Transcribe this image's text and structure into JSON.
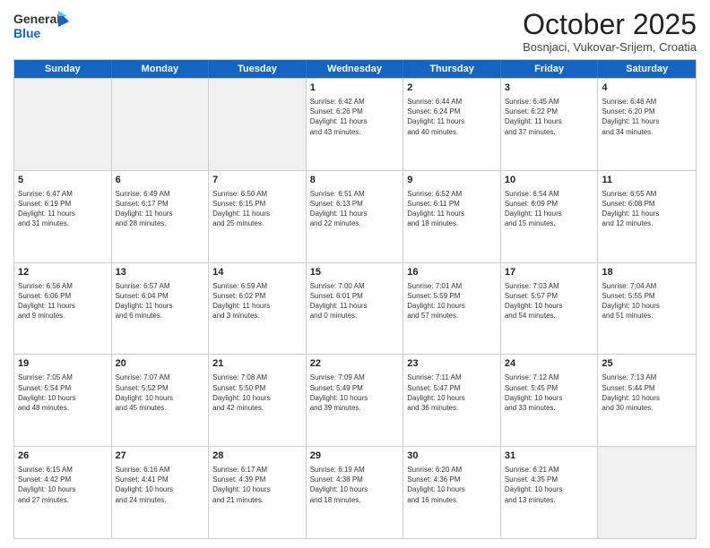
{
  "header": {
    "logo_general": "General",
    "logo_blue": "Blue",
    "month": "October 2025",
    "location": "Bosnjaci, Vukovar-Srijem, Croatia"
  },
  "days_of_week": [
    "Sunday",
    "Monday",
    "Tuesday",
    "Wednesday",
    "Thursday",
    "Friday",
    "Saturday"
  ],
  "rows": [
    {
      "cells": [
        {
          "day": "",
          "info": "",
          "shaded": true
        },
        {
          "day": "",
          "info": "",
          "shaded": true
        },
        {
          "day": "",
          "info": "",
          "shaded": true
        },
        {
          "day": "1",
          "info": "Sunrise: 6:42 AM\nSunset: 6:26 PM\nDaylight: 11 hours\nand 43 minutes."
        },
        {
          "day": "2",
          "info": "Sunrise: 6:44 AM\nSunset: 6:24 PM\nDaylight: 11 hours\nand 40 minutes."
        },
        {
          "day": "3",
          "info": "Sunrise: 6:45 AM\nSunset: 6:22 PM\nDaylight: 11 hours\nand 37 minutes."
        },
        {
          "day": "4",
          "info": "Sunrise: 6:46 AM\nSunset: 6:20 PM\nDaylight: 11 hours\nand 34 minutes."
        }
      ]
    },
    {
      "cells": [
        {
          "day": "5",
          "info": "Sunrise: 6:47 AM\nSunset: 6:19 PM\nDaylight: 11 hours\nand 31 minutes."
        },
        {
          "day": "6",
          "info": "Sunrise: 6:49 AM\nSunset: 6:17 PM\nDaylight: 11 hours\nand 28 minutes."
        },
        {
          "day": "7",
          "info": "Sunrise: 6:50 AM\nSunset: 6:15 PM\nDaylight: 11 hours\nand 25 minutes."
        },
        {
          "day": "8",
          "info": "Sunrise: 6:51 AM\nSunset: 6:13 PM\nDaylight: 11 hours\nand 22 minutes."
        },
        {
          "day": "9",
          "info": "Sunrise: 6:52 AM\nSunset: 6:11 PM\nDaylight: 11 hours\nand 18 minutes."
        },
        {
          "day": "10",
          "info": "Sunrise: 6:54 AM\nSunset: 6:09 PM\nDaylight: 11 hours\nand 15 minutes."
        },
        {
          "day": "11",
          "info": "Sunrise: 6:55 AM\nSunset: 6:08 PM\nDaylight: 11 hours\nand 12 minutes."
        }
      ]
    },
    {
      "cells": [
        {
          "day": "12",
          "info": "Sunrise: 6:56 AM\nSunset: 6:06 PM\nDaylight: 11 hours\nand 9 minutes."
        },
        {
          "day": "13",
          "info": "Sunrise: 6:57 AM\nSunset: 6:04 PM\nDaylight: 11 hours\nand 6 minutes."
        },
        {
          "day": "14",
          "info": "Sunrise: 6:59 AM\nSunset: 6:02 PM\nDaylight: 11 hours\nand 3 minutes."
        },
        {
          "day": "15",
          "info": "Sunrise: 7:00 AM\nSunset: 6:01 PM\nDaylight: 11 hours\nand 0 minutes."
        },
        {
          "day": "16",
          "info": "Sunrise: 7:01 AM\nSunset: 5:59 PM\nDaylight: 10 hours\nand 57 minutes."
        },
        {
          "day": "17",
          "info": "Sunrise: 7:03 AM\nSunset: 5:57 PM\nDaylight: 10 hours\nand 54 minutes."
        },
        {
          "day": "18",
          "info": "Sunrise: 7:04 AM\nSunset: 5:55 PM\nDaylight: 10 hours\nand 51 minutes."
        }
      ]
    },
    {
      "cells": [
        {
          "day": "19",
          "info": "Sunrise: 7:05 AM\nSunset: 5:54 PM\nDaylight: 10 hours\nand 48 minutes."
        },
        {
          "day": "20",
          "info": "Sunrise: 7:07 AM\nSunset: 5:52 PM\nDaylight: 10 hours\nand 45 minutes."
        },
        {
          "day": "21",
          "info": "Sunrise: 7:08 AM\nSunset: 5:50 PM\nDaylight: 10 hours\nand 42 minutes."
        },
        {
          "day": "22",
          "info": "Sunrise: 7:09 AM\nSunset: 5:49 PM\nDaylight: 10 hours\nand 39 minutes."
        },
        {
          "day": "23",
          "info": "Sunrise: 7:11 AM\nSunset: 5:47 PM\nDaylight: 10 hours\nand 36 minutes."
        },
        {
          "day": "24",
          "info": "Sunrise: 7:12 AM\nSunset: 5:45 PM\nDaylight: 10 hours\nand 33 minutes."
        },
        {
          "day": "25",
          "info": "Sunrise: 7:13 AM\nSunset: 5:44 PM\nDaylight: 10 hours\nand 30 minutes."
        }
      ]
    },
    {
      "cells": [
        {
          "day": "26",
          "info": "Sunrise: 6:15 AM\nSunset: 4:42 PM\nDaylight: 10 hours\nand 27 minutes."
        },
        {
          "day": "27",
          "info": "Sunrise: 6:16 AM\nSunset: 4:41 PM\nDaylight: 10 hours\nand 24 minutes."
        },
        {
          "day": "28",
          "info": "Sunrise: 6:17 AM\nSunset: 4:39 PM\nDaylight: 10 hours\nand 21 minutes."
        },
        {
          "day": "29",
          "info": "Sunrise: 6:19 AM\nSunset: 4:38 PM\nDaylight: 10 hours\nand 18 minutes."
        },
        {
          "day": "30",
          "info": "Sunrise: 6:20 AM\nSunset: 4:36 PM\nDaylight: 10 hours\nand 16 minutes."
        },
        {
          "day": "31",
          "info": "Sunrise: 6:21 AM\nSunset: 4:35 PM\nDaylight: 10 hours\nand 13 minutes."
        },
        {
          "day": "",
          "info": "",
          "shaded": true
        }
      ]
    }
  ]
}
